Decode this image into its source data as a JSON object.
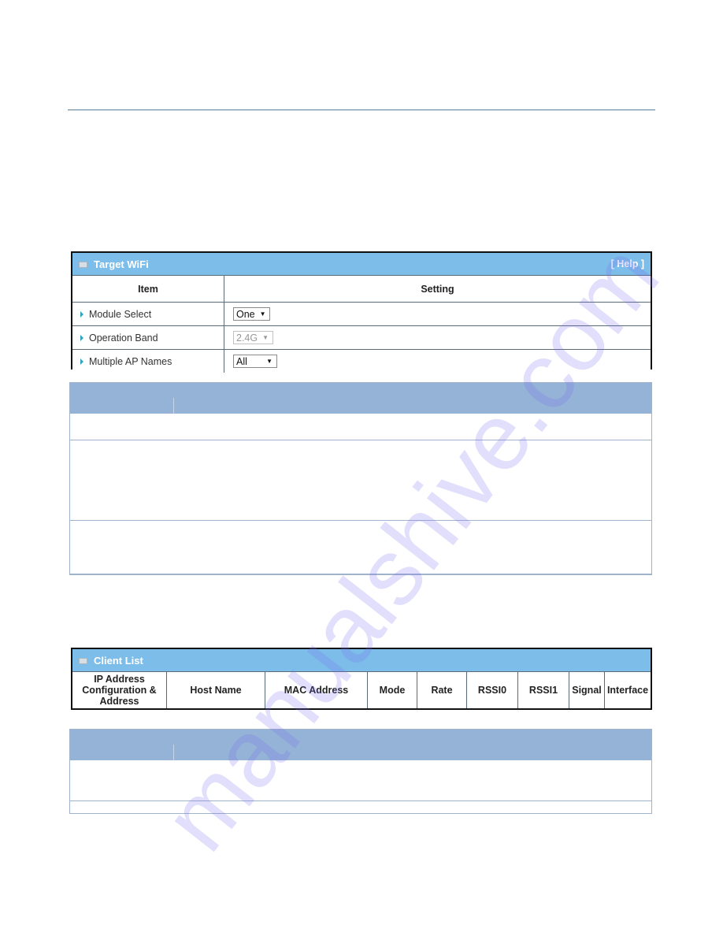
{
  "target_wifi": {
    "title": "Target WiFi",
    "help_label": "[ Help ]",
    "columns": [
      "Item",
      "Setting"
    ],
    "rows": [
      {
        "label": "Module Select",
        "value": "One",
        "disabled": false
      },
      {
        "label": "Operation Band",
        "value": "2.4G",
        "disabled": true
      },
      {
        "label": "Multiple AP Names",
        "value": "All",
        "disabled": false
      }
    ]
  },
  "client_list": {
    "title": "Client List",
    "columns": [
      "IP Address Configuration & Address",
      "Host Name",
      "MAC Address",
      "Mode",
      "Rate",
      "RSSI0",
      "RSSI1",
      "Signal",
      "Interface"
    ]
  },
  "icons": {
    "panel_icon": "panel-bullet-icon",
    "row_bullet": "triangle-right-icon",
    "dropdown_arrow": "caret-down-icon"
  },
  "colors": {
    "panel_header": "#7dbde9",
    "desc_header": "#95b3d7",
    "row_bullet": "#33a3c2"
  },
  "watermark": "manualshive.com"
}
